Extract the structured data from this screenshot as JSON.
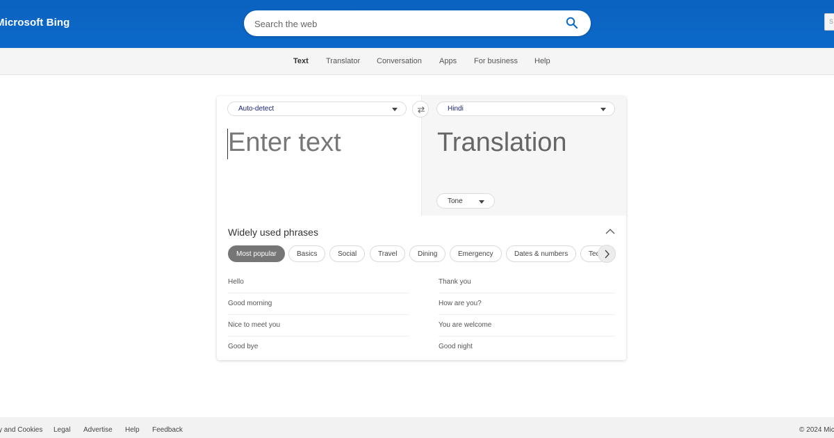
{
  "header": {
    "brand": "Microsoft Bing",
    "search_placeholder": "Search the web",
    "corner_button": "S"
  },
  "nav": {
    "items": [
      "Text",
      "Translator",
      "Conversation",
      "Apps",
      "For business",
      "Help"
    ],
    "active": "Text"
  },
  "translator": {
    "source_language": "Auto-detect",
    "target_language": "Hindi",
    "input_placeholder": "Enter text",
    "output_placeholder": "Translation",
    "tone_label": "Tone"
  },
  "phrases": {
    "title": "Widely used phrases",
    "categories": [
      "Most popular",
      "Basics",
      "Social",
      "Travel",
      "Dining",
      "Emergency",
      "Dates & numbers",
      "Tec"
    ],
    "active_category": "Most popular",
    "left": [
      "Hello",
      "Good morning",
      "Nice to meet you",
      "Good bye"
    ],
    "right": [
      "Thank you",
      "How are you?",
      "You are welcome",
      "Good night"
    ]
  },
  "footer": {
    "links": [
      "y and Cookies",
      "Legal",
      "Advertise",
      "Help",
      "Feedback"
    ],
    "copyright": "© 2024 Mic"
  },
  "colors": {
    "header_bg": "#0b62bf",
    "active_chip": "#767676",
    "language_text": "#1a237e"
  },
  "icons": [
    "search-icon",
    "swap-icon",
    "chevron-down-icon",
    "chevron-up-icon",
    "chevron-right-icon"
  ]
}
